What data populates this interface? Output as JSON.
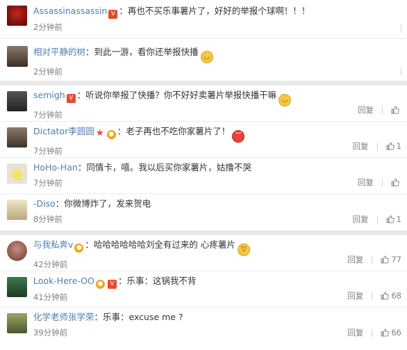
{
  "comments": [
    {
      "name": "Assassinassassin",
      "badges": [
        "red"
      ],
      "text": "：再也不买乐事薯片了，好好的举报个球啊！！！",
      "time": "2分钟前",
      "reply": "",
      "likes": "",
      "avatar": "#7a1010"
    },
    {
      "name": "相对平静的树",
      "badges": [],
      "text": "：到此一游，看你还举报快播",
      "emoji": "smirk",
      "time": "2分钟前",
      "reply": "",
      "likes": "",
      "avatar": "#6b5a4a"
    },
    {
      "name": "semigh",
      "badges": [
        "red"
      ],
      "text": "：听说你举报了快播？你不好好卖薯片举报快播干嘛",
      "emoji": "smirk",
      "time": "7分钟前",
      "reply": "回复",
      "likes": "",
      "avatar": "#3a3a3a"
    },
    {
      "name": "Dictator李圆圆",
      "badges": [
        "star",
        "gold"
      ],
      "text": "：老子再也不吃你家薯片了！",
      "emoji": "angry",
      "time": "7分钟前",
      "reply": "回复",
      "likes": "1",
      "avatar": "#4a4038"
    },
    {
      "name": "HoHo-Han",
      "badges": [],
      "text": "：同情卡，嘻。我以后买你家薯片，姑撸不哭",
      "time": "7分钟前",
      "reply": "回复",
      "likes": "",
      "avatar": "#e9e4d0"
    },
    {
      "name": "-Diso",
      "badges": [],
      "text": "：你微博炸了，发来贺电",
      "time": "8分钟前",
      "reply": "回复",
      "likes": "1",
      "avatar": "#d8c9a2"
    },
    {
      "name": "与我私奔v",
      "badges": [
        "gold"
      ],
      "text": "：哈哈哈哈哈哈刘全有过来的 心疼薯片",
      "emoji": "laugh",
      "time": "42分钟前",
      "reply": "回复",
      "likes": "77",
      "avatar": "#9a6a5a"
    },
    {
      "name": "Look-Here-OO",
      "badges": [
        "gold",
        "red"
      ],
      "text": "：乐事：这锅我不背",
      "time": "41分钟前",
      "reply": "回复",
      "likes": "68",
      "avatar": "#2f5a3a"
    },
    {
      "name": "化学老师张学荣",
      "badges": [],
      "text": "：乐事：excuse me ?",
      "time": "39分钟前",
      "reply": "回复",
      "likes": "66",
      "avatar": "#6b7a4a"
    }
  ],
  "colors": {
    "name": "#eb7350",
    "link": "#507daf",
    "muted": "#808080"
  }
}
